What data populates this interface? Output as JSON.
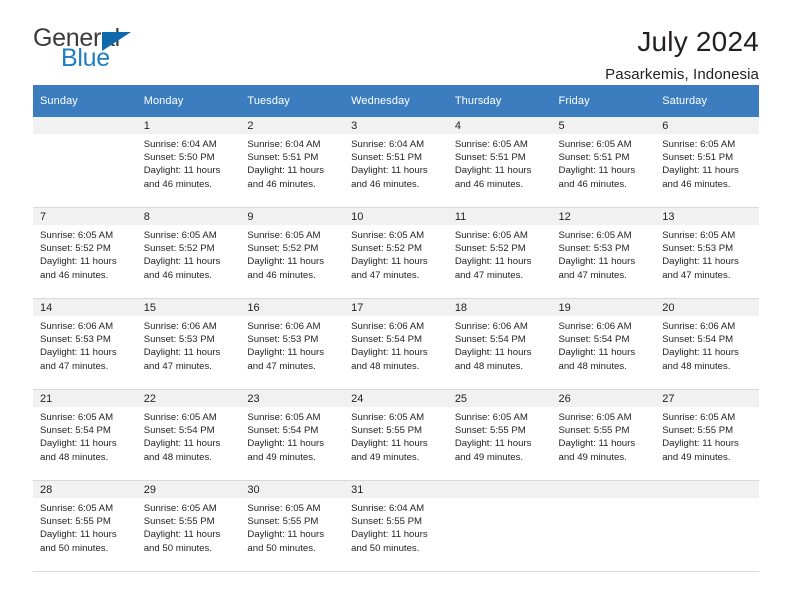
{
  "brand": {
    "name_top": "General",
    "name_bottom": "Blue",
    "triangle_color": "#1068ad",
    "blue_color": "#1f7ec2"
  },
  "header": {
    "title": "July 2024",
    "subtitle": "Pasarkemis, Indonesia"
  },
  "theme": {
    "header_row_bg": "#3b7dbf",
    "daynum_bg": "#f1f1f1",
    "text_color": "#231f20",
    "grid_line": "#d9d9d9"
  },
  "weekdays": [
    "Sunday",
    "Monday",
    "Tuesday",
    "Wednesday",
    "Thursday",
    "Friday",
    "Saturday"
  ],
  "labels": {
    "sunrise_prefix": "Sunrise:",
    "sunset_prefix": "Sunset:",
    "daylight_prefix": "Daylight:"
  },
  "weeks": [
    [
      {
        "day": "",
        "lines": []
      },
      {
        "day": "1",
        "lines": [
          "Sunrise: 6:04 AM",
          "Sunset: 5:50 PM",
          "Daylight: 11 hours",
          "and 46 minutes."
        ]
      },
      {
        "day": "2",
        "lines": [
          "Sunrise: 6:04 AM",
          "Sunset: 5:51 PM",
          "Daylight: 11 hours",
          "and 46 minutes."
        ]
      },
      {
        "day": "3",
        "lines": [
          "Sunrise: 6:04 AM",
          "Sunset: 5:51 PM",
          "Daylight: 11 hours",
          "and 46 minutes."
        ]
      },
      {
        "day": "4",
        "lines": [
          "Sunrise: 6:05 AM",
          "Sunset: 5:51 PM",
          "Daylight: 11 hours",
          "and 46 minutes."
        ]
      },
      {
        "day": "5",
        "lines": [
          "Sunrise: 6:05 AM",
          "Sunset: 5:51 PM",
          "Daylight: 11 hours",
          "and 46 minutes."
        ]
      },
      {
        "day": "6",
        "lines": [
          "Sunrise: 6:05 AM",
          "Sunset: 5:51 PM",
          "Daylight: 11 hours",
          "and 46 minutes."
        ]
      }
    ],
    [
      {
        "day": "7",
        "lines": [
          "Sunrise: 6:05 AM",
          "Sunset: 5:52 PM",
          "Daylight: 11 hours",
          "and 46 minutes."
        ]
      },
      {
        "day": "8",
        "lines": [
          "Sunrise: 6:05 AM",
          "Sunset: 5:52 PM",
          "Daylight: 11 hours",
          "and 46 minutes."
        ]
      },
      {
        "day": "9",
        "lines": [
          "Sunrise: 6:05 AM",
          "Sunset: 5:52 PM",
          "Daylight: 11 hours",
          "and 46 minutes."
        ]
      },
      {
        "day": "10",
        "lines": [
          "Sunrise: 6:05 AM",
          "Sunset: 5:52 PM",
          "Daylight: 11 hours",
          "and 47 minutes."
        ]
      },
      {
        "day": "11",
        "lines": [
          "Sunrise: 6:05 AM",
          "Sunset: 5:52 PM",
          "Daylight: 11 hours",
          "and 47 minutes."
        ]
      },
      {
        "day": "12",
        "lines": [
          "Sunrise: 6:05 AM",
          "Sunset: 5:53 PM",
          "Daylight: 11 hours",
          "and 47 minutes."
        ]
      },
      {
        "day": "13",
        "lines": [
          "Sunrise: 6:05 AM",
          "Sunset: 5:53 PM",
          "Daylight: 11 hours",
          "and 47 minutes."
        ]
      }
    ],
    [
      {
        "day": "14",
        "lines": [
          "Sunrise: 6:06 AM",
          "Sunset: 5:53 PM",
          "Daylight: 11 hours",
          "and 47 minutes."
        ]
      },
      {
        "day": "15",
        "lines": [
          "Sunrise: 6:06 AM",
          "Sunset: 5:53 PM",
          "Daylight: 11 hours",
          "and 47 minutes."
        ]
      },
      {
        "day": "16",
        "lines": [
          "Sunrise: 6:06 AM",
          "Sunset: 5:53 PM",
          "Daylight: 11 hours",
          "and 47 minutes."
        ]
      },
      {
        "day": "17",
        "lines": [
          "Sunrise: 6:06 AM",
          "Sunset: 5:54 PM",
          "Daylight: 11 hours",
          "and 48 minutes."
        ]
      },
      {
        "day": "18",
        "lines": [
          "Sunrise: 6:06 AM",
          "Sunset: 5:54 PM",
          "Daylight: 11 hours",
          "and 48 minutes."
        ]
      },
      {
        "day": "19",
        "lines": [
          "Sunrise: 6:06 AM",
          "Sunset: 5:54 PM",
          "Daylight: 11 hours",
          "and 48 minutes."
        ]
      },
      {
        "day": "20",
        "lines": [
          "Sunrise: 6:06 AM",
          "Sunset: 5:54 PM",
          "Daylight: 11 hours",
          "and 48 minutes."
        ]
      }
    ],
    [
      {
        "day": "21",
        "lines": [
          "Sunrise: 6:05 AM",
          "Sunset: 5:54 PM",
          "Daylight: 11 hours",
          "and 48 minutes."
        ]
      },
      {
        "day": "22",
        "lines": [
          "Sunrise: 6:05 AM",
          "Sunset: 5:54 PM",
          "Daylight: 11 hours",
          "and 48 minutes."
        ]
      },
      {
        "day": "23",
        "lines": [
          "Sunrise: 6:05 AM",
          "Sunset: 5:54 PM",
          "Daylight: 11 hours",
          "and 49 minutes."
        ]
      },
      {
        "day": "24",
        "lines": [
          "Sunrise: 6:05 AM",
          "Sunset: 5:55 PM",
          "Daylight: 11 hours",
          "and 49 minutes."
        ]
      },
      {
        "day": "25",
        "lines": [
          "Sunrise: 6:05 AM",
          "Sunset: 5:55 PM",
          "Daylight: 11 hours",
          "and 49 minutes."
        ]
      },
      {
        "day": "26",
        "lines": [
          "Sunrise: 6:05 AM",
          "Sunset: 5:55 PM",
          "Daylight: 11 hours",
          "and 49 minutes."
        ]
      },
      {
        "day": "27",
        "lines": [
          "Sunrise: 6:05 AM",
          "Sunset: 5:55 PM",
          "Daylight: 11 hours",
          "and 49 minutes."
        ]
      }
    ],
    [
      {
        "day": "28",
        "lines": [
          "Sunrise: 6:05 AM",
          "Sunset: 5:55 PM",
          "Daylight: 11 hours",
          "and 50 minutes."
        ]
      },
      {
        "day": "29",
        "lines": [
          "Sunrise: 6:05 AM",
          "Sunset: 5:55 PM",
          "Daylight: 11 hours",
          "and 50 minutes."
        ]
      },
      {
        "day": "30",
        "lines": [
          "Sunrise: 6:05 AM",
          "Sunset: 5:55 PM",
          "Daylight: 11 hours",
          "and 50 minutes."
        ]
      },
      {
        "day": "31",
        "lines": [
          "Sunrise: 6:04 AM",
          "Sunset: 5:55 PM",
          "Daylight: 11 hours",
          "and 50 minutes."
        ]
      },
      {
        "day": "",
        "lines": []
      },
      {
        "day": "",
        "lines": []
      },
      {
        "day": "",
        "lines": []
      }
    ]
  ]
}
